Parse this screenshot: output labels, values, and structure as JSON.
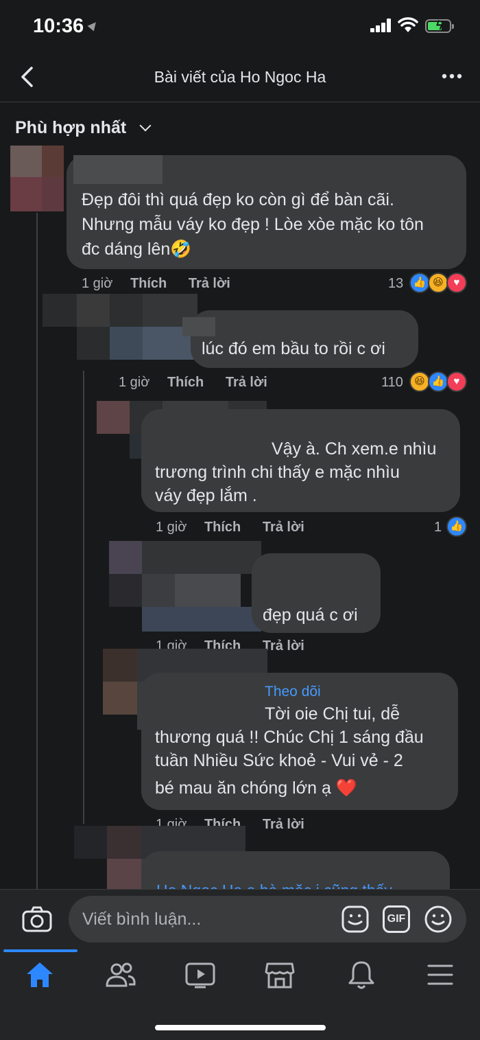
{
  "status_bar": {
    "time": "10:36"
  },
  "header": {
    "title": "Bài viết của Ho Ngoc Ha"
  },
  "sort": {
    "label": "Phù hợp nhất"
  },
  "comments": [
    {
      "text_lines": [
        "Đẹp đôi thì quá đẹp ko còn gì để bàn cãi.",
        "Nhưng mẫu váy ko đẹp ! Lòe xòe mặc ko tôn",
        "đc dáng lên🤣"
      ],
      "time": "1 giờ",
      "like": "Thích",
      "reply": "Trả lời",
      "count": "13"
    },
    {
      "text_lines": [
        "lúc đó em bầu to rồi c ơi"
      ],
      "time": "1 giờ",
      "like": "Thích",
      "reply": "Trả lời",
      "count": "110"
    },
    {
      "text_lines": [
        "Vậy à. Ch xem.e nhìu",
        "trương trình chi thấy e mặc nhìu",
        "váy đẹp lắm ."
      ],
      "time": "1 giờ",
      "like": "Thích",
      "reply": "Trả lời",
      "count": "1"
    },
    {
      "text_lines": [
        "đẹp quá c ơi"
      ],
      "time": "1 giờ",
      "like": "Thích",
      "reply": "Trả lời"
    },
    {
      "follow": "Theo dõi",
      "text_lines": [
        "Tời oie Chị tui, dễ",
        "thương quá !! Chúc Chị 1 sáng đầu",
        "tuần Nhiều Sức khoẻ - Vui vẻ - 2",
        "bé mau ăn chóng lớn ạ ❤️"
      ],
      "time": "1 giờ",
      "like": "Thích",
      "reply": "Trả lời"
    },
    {
      "partial_text": "Ho Ngoc Ha e bà mặc j cũng thấy"
    }
  ],
  "composer": {
    "placeholder": "Viết bình luận...",
    "gif": "GIF"
  },
  "bottom_nav": [
    "home-icon",
    "friends-icon",
    "watch-icon",
    "marketplace-icon",
    "notifications-icon",
    "menu-icon"
  ],
  "colors": {
    "background": "#18191a",
    "bubble": "#3a3b3c",
    "accent": "#2d88ff",
    "love": "#f33e58",
    "haha": "#f7b125"
  }
}
